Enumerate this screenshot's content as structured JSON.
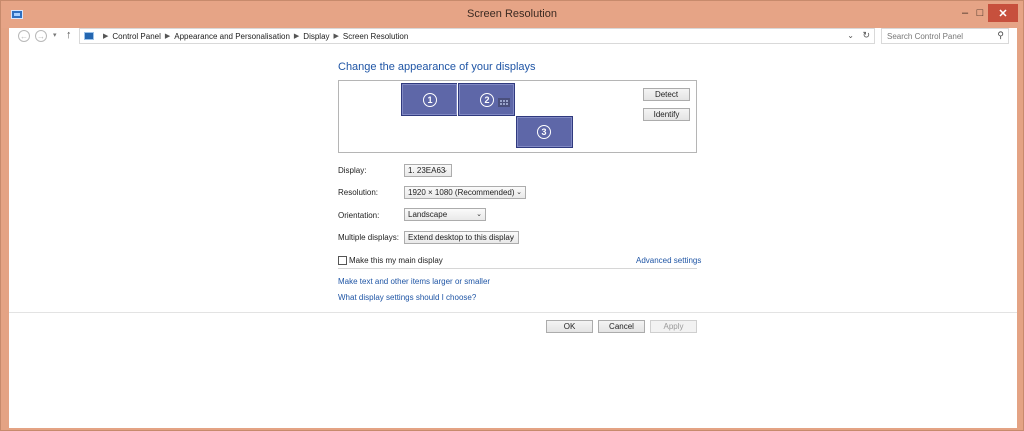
{
  "window": {
    "title": "Screen Resolution",
    "controls": {
      "minimize": "–",
      "maximize": "□",
      "close": "✕"
    }
  },
  "navbar": {
    "breadcrumbs": [
      "Control Panel",
      "Appearance and Personalisation",
      "Display",
      "Screen Resolution"
    ],
    "search_placeholder": "Search Control Panel"
  },
  "main": {
    "heading": "Change the appearance of your displays",
    "monitors": [
      "1",
      "2",
      "3"
    ],
    "detect_label": "Detect",
    "identify_label": "Identify",
    "display": {
      "label": "Display:",
      "value": "1. 23EA63"
    },
    "resolution": {
      "label": "Resolution:",
      "value": "1920 × 1080 (Recommended)"
    },
    "orientation": {
      "label": "Orientation:",
      "value": "Landscape"
    },
    "multiple_displays": {
      "label": "Multiple displays:",
      "value": "Extend desktop to this display"
    },
    "main_display_label": "Make this my main display",
    "main_display_checked": false,
    "advanced_link": "Advanced settings",
    "text_size_link": "Make text and other items larger or smaller",
    "help_link": "What display settings should I choose?"
  },
  "footer": {
    "ok_label": "OK",
    "cancel_label": "Cancel",
    "apply_label": "Apply"
  },
  "colors": {
    "title_bar": "#e6a486",
    "close_button": "#c7503d",
    "link": "#1f55a5",
    "monitor": "#5e67a8"
  }
}
